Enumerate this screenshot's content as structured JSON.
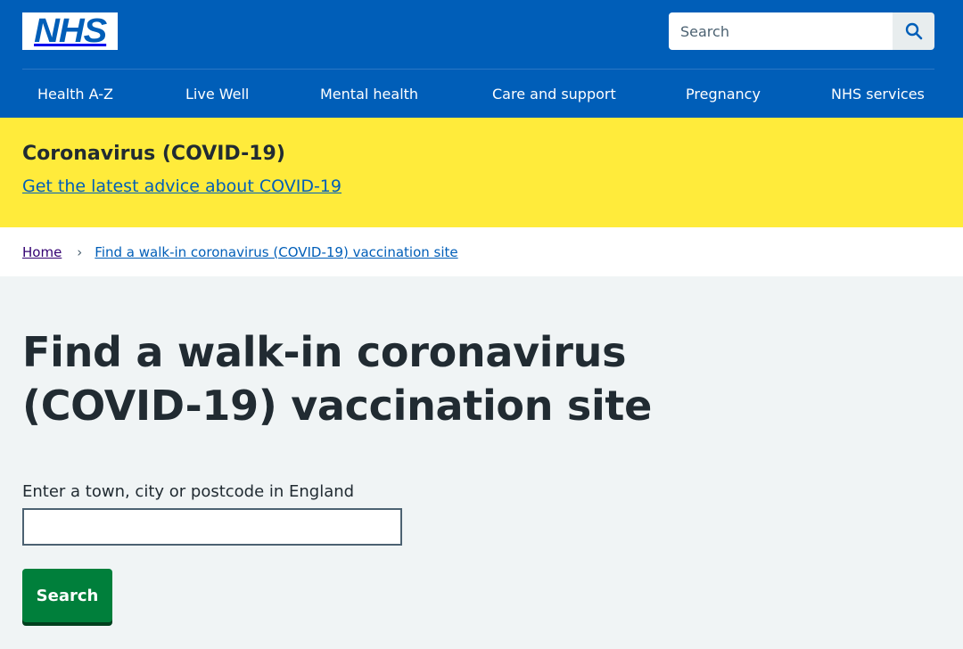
{
  "header": {
    "logo_text": "NHS",
    "search": {
      "placeholder": "Search",
      "button_icon": "search-icon"
    },
    "nav": [
      {
        "label": "Health A-Z"
      },
      {
        "label": "Live Well"
      },
      {
        "label": "Mental health"
      },
      {
        "label": "Care and support"
      },
      {
        "label": "Pregnancy"
      },
      {
        "label": "NHS services"
      }
    ]
  },
  "banner": {
    "title": "Coronavirus (COVID-19)",
    "link": "Get the latest advice about COVID-19"
  },
  "breadcrumb": {
    "home": "Home",
    "separator": "›",
    "current": "Find a walk-in coronavirus (COVID-19) vaccination site"
  },
  "main": {
    "title": "Find a walk-in coronavirus (COVID-19) vaccination site",
    "field_label": "Enter a town, city or postcode in England",
    "field_value": "",
    "submit_label": "Search"
  },
  "colors": {
    "nhs_blue": "#005eb8",
    "banner_yellow": "#ffeb3b",
    "button_green": "#007f3b",
    "page_background": "#f0f4f5"
  }
}
